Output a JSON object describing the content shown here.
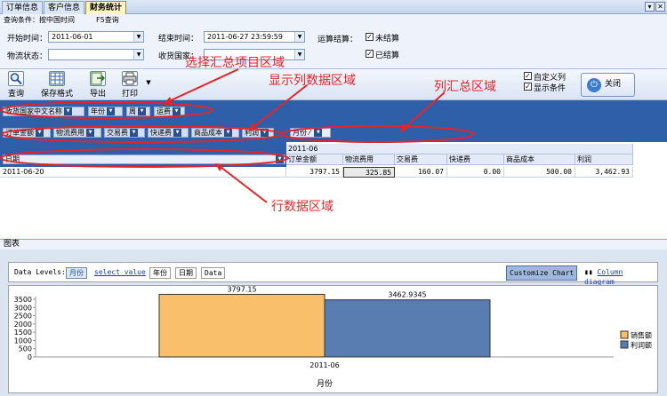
{
  "tabs": [
    {
      "label": "订单信息"
    },
    {
      "label": "客户信息"
    },
    {
      "label": "财务统计"
    }
  ],
  "window_buttons": {
    "dropdown": "▾",
    "close": "✕"
  },
  "query": {
    "condition_label": "查询条件：按中国时间",
    "f5_label": "F5查询",
    "start_label": "开始时间：",
    "start_value": "2011-06-01",
    "end_label": "结束时间：",
    "end_value": "2011-06-27 23:59:59",
    "settle_label": "运算结算：",
    "unsettled_label": "未结算",
    "settled_label": "已结算",
    "logistics_label": "物流状态：",
    "logistics_value": "",
    "country_label": "收货国家：",
    "country_value": ""
  },
  "toolbar": {
    "query": "查询",
    "save_format": "保存格式",
    "export": "导出",
    "print": "打印",
    "custom_column": "自定义列",
    "show_condition": "显示条件",
    "close": "关闭"
  },
  "annotations": {
    "summary_area": "选择汇总项目区域",
    "data_area": "显示列数据区域",
    "column_area": "列汇总区域",
    "row_area": "行数据区域"
  },
  "pivot": {
    "filter_fields": [
      "收货国家中文名称",
      "年份",
      "周",
      "运费"
    ],
    "data_fields": [
      "订单金额",
      "物流费用",
      "交易费",
      "快递费",
      "商品成本",
      "利润"
    ],
    "column_field": "月份",
    "column_value": "2011-06",
    "row_field": "日期",
    "row_header": "2011-06-20",
    "col_headers": [
      "订单金额",
      "物流费用",
      "交易费",
      "快递费",
      "商品成本",
      "利润"
    ],
    "row_values": [
      "3797.15",
      "325.85",
      "160.07",
      "0.00",
      "500.00",
      "3,462.93"
    ]
  },
  "chart_panel": {
    "label": "图表",
    "data_levels_label": "Data Levels:",
    "level_month": "月份",
    "level_select": "select value",
    "level_year": "年份",
    "level_day": "日期",
    "level_data": "Data",
    "customize": "Customize Chart",
    "column_diagram": "Column diagram"
  },
  "chart_data": {
    "type": "bar",
    "categories": [
      "2011-06"
    ],
    "series": [
      {
        "name": "销售额",
        "values": [
          3797.15
        ],
        "color": "#f9bf6b"
      },
      {
        "name": "利润额",
        "values": [
          3462.9345
        ],
        "color": "#5a7db1"
      }
    ],
    "value_labels": [
      "3797.15",
      "3462.9345"
    ],
    "xlabel": "月份",
    "ylabel": "",
    "ylim": [
      0,
      3500
    ],
    "yticks": [
      "3500",
      "3000",
      "2500",
      "2000",
      "1500",
      "1000",
      "500",
      "0"
    ],
    "grid": false,
    "legend": "right"
  }
}
